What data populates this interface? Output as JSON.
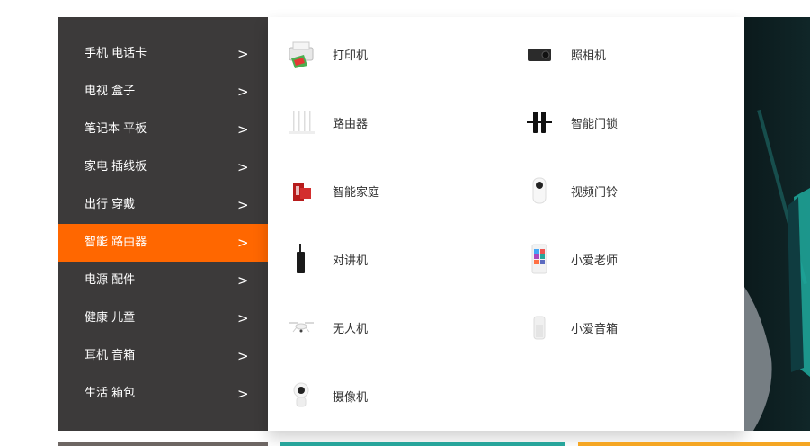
{
  "categories": [
    {
      "label": "手机 电话卡",
      "arrow": ">"
    },
    {
      "label": "电视 盒子",
      "arrow": ">"
    },
    {
      "label": "笔记本 平板",
      "arrow": ">"
    },
    {
      "label": "家电 插线板",
      "arrow": ">"
    },
    {
      "label": "出行 穿戴",
      "arrow": ">"
    },
    {
      "label": "智能 路由器",
      "arrow": ">"
    },
    {
      "label": "电源 配件",
      "arrow": ">"
    },
    {
      "label": "健康 儿童",
      "arrow": ">"
    },
    {
      "label": "耳机 音箱",
      "arrow": ">"
    },
    {
      "label": "生活 箱包",
      "arrow": ">"
    }
  ],
  "active_category": "智能 路由器",
  "products": [
    {
      "name": "打印机",
      "icon": "printer-icon"
    },
    {
      "name": "照相机",
      "icon": "camera-icon"
    },
    {
      "name": "路由器",
      "icon": "router-icon"
    },
    {
      "name": "智能门锁",
      "icon": "door-lock-icon"
    },
    {
      "name": "智能家庭",
      "icon": "smart-home-icon"
    },
    {
      "name": "视频门铃",
      "icon": "video-doorbell-icon"
    },
    {
      "name": "对讲机",
      "icon": "walkie-talkie-icon"
    },
    {
      "name": "小爱老师",
      "icon": "xiaoai-teacher-icon"
    },
    {
      "name": "无人机",
      "icon": "drone-icon"
    },
    {
      "name": "小爱音箱",
      "icon": "xiaoai-speaker-icon"
    },
    {
      "name": "摄像机",
      "icon": "security-camera-icon"
    }
  ],
  "colors": {
    "accent": "#ff6700",
    "sidebar_bg": "#3c3a3a"
  }
}
